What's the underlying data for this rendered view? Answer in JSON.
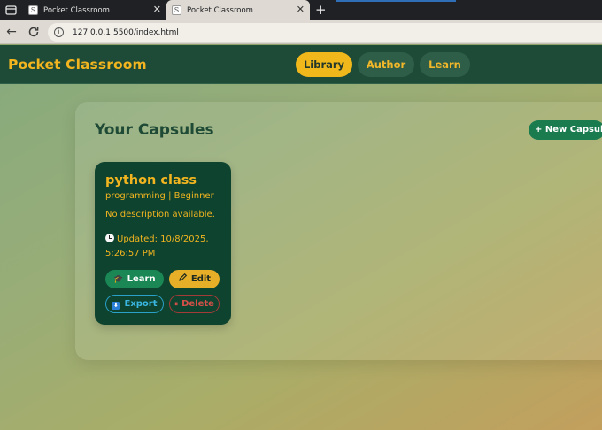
{
  "browser": {
    "tabs": [
      {
        "title": "Pocket Classroom",
        "active": false
      },
      {
        "title": "Pocket Classroom",
        "active": true
      }
    ],
    "address": "127.0.0.1:5500/index.html"
  },
  "header": {
    "brand": "Pocket Classroom",
    "nav": [
      {
        "label": "Library",
        "active": true
      },
      {
        "label": "Author",
        "active": false
      },
      {
        "label": "Learn",
        "active": false
      }
    ]
  },
  "library": {
    "title": "Your Capsules",
    "new_button": "+ New Capsule",
    "capsules": [
      {
        "title": "python class",
        "meta": "programming | Beginner",
        "description": "No description available.",
        "updated": "Updated: 10/8/2025, 5:26:57 PM",
        "actions": {
          "learn": "Learn",
          "edit": "Edit",
          "export": "Export",
          "delete": "Delete"
        }
      }
    ]
  },
  "icons": {
    "tab_menu": "tab-menu-icon",
    "favicon": "favicon-icon",
    "close": "close-icon",
    "new_tab": "plus-icon",
    "back": "back-arrow-icon",
    "reload": "reload-icon",
    "site_info": "info-icon",
    "clock": "clock-icon",
    "learn": "graduation-cap-icon",
    "edit": "pencil-icon",
    "export": "download-icon",
    "delete": "pause-icon"
  },
  "colors": {
    "header_bg": "#1e4b38",
    "brand_gold": "#f2b51f",
    "card_bg": "#0e4330",
    "primary_green": "#1a7b4f",
    "export_blue": "#3ab6e0",
    "delete_red": "#d65048"
  }
}
